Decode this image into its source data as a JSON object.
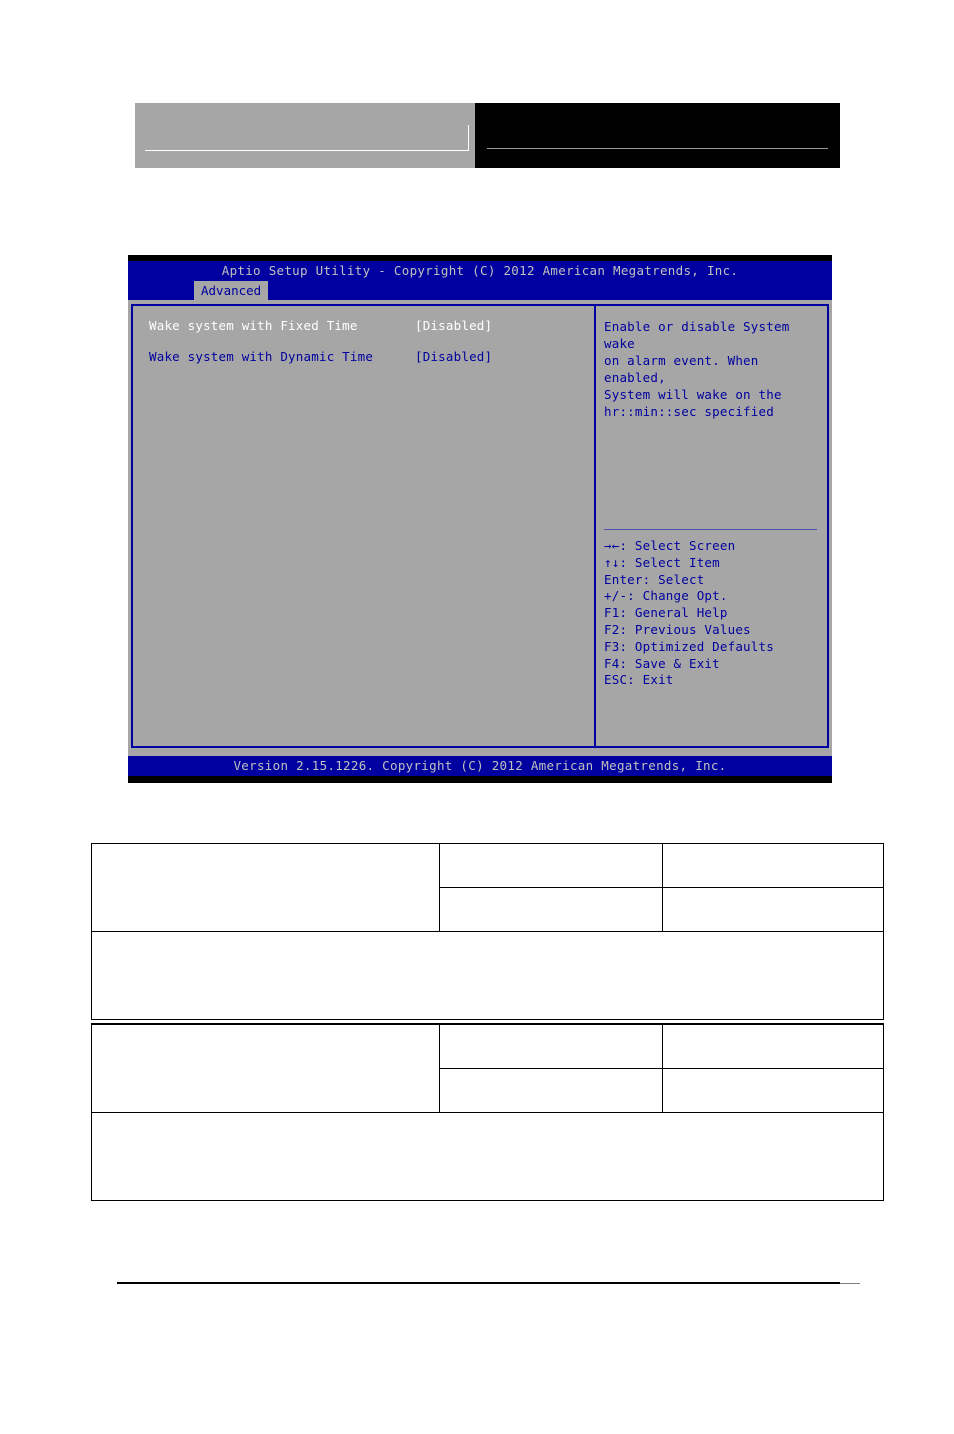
{
  "page": {
    "header": {
      "left_box_label": "",
      "right_box_label": ""
    },
    "bottom_rule": true
  },
  "bios": {
    "title": "Aptio Setup Utility - Copyright (C) 2012 American Megatrends, Inc.",
    "active_tab": "Advanced",
    "tabs": [
      "Advanced"
    ],
    "settings": [
      {
        "label": "Wake system with Fixed Time",
        "value": "[Disabled]",
        "selected": true,
        "color": "#ffffff"
      },
      {
        "label": "Wake system with Dynamic Time",
        "value": "[Disabled]",
        "selected": false,
        "color": "#00009f"
      }
    ],
    "help": {
      "text": "Enable or disable System wake\non alarm event. When enabled,\nSystem will wake on the\nhr::min::sec specified"
    },
    "keys": [
      "→←: Select Screen",
      "↑↓: Select Item",
      "Enter: Select",
      "+/-: Change Opt.",
      "F1: General Help",
      "F2: Previous Values",
      "F3: Optimized Defaults",
      "F4: Save & Exit",
      "ESC: Exit"
    ],
    "footer": "Version 2.15.1226. Copyright (C) 2012 American Megatrends, Inc.",
    "colors": {
      "screen_blue": "#0000a0",
      "panel_gray": "#a6a6a6",
      "title_text": "#c0c0c0",
      "selected_text": "#ffffff",
      "normal_text": "#00009f"
    }
  },
  "tables": [
    {
      "name": "spec-table-upper",
      "rows": [
        {
          "type": "split",
          "cells": [
            "",
            "",
            ""
          ]
        },
        {
          "type": "split",
          "cells": [
            "",
            "",
            ""
          ]
        },
        {
          "type": "note",
          "cells": [
            ""
          ]
        }
      ]
    },
    {
      "name": "spec-table-lower",
      "rows": [
        {
          "type": "split",
          "cells": [
            "",
            "",
            ""
          ]
        },
        {
          "type": "split",
          "cells": [
            "",
            "",
            ""
          ]
        },
        {
          "type": "note",
          "cells": [
            ""
          ]
        }
      ]
    }
  ]
}
